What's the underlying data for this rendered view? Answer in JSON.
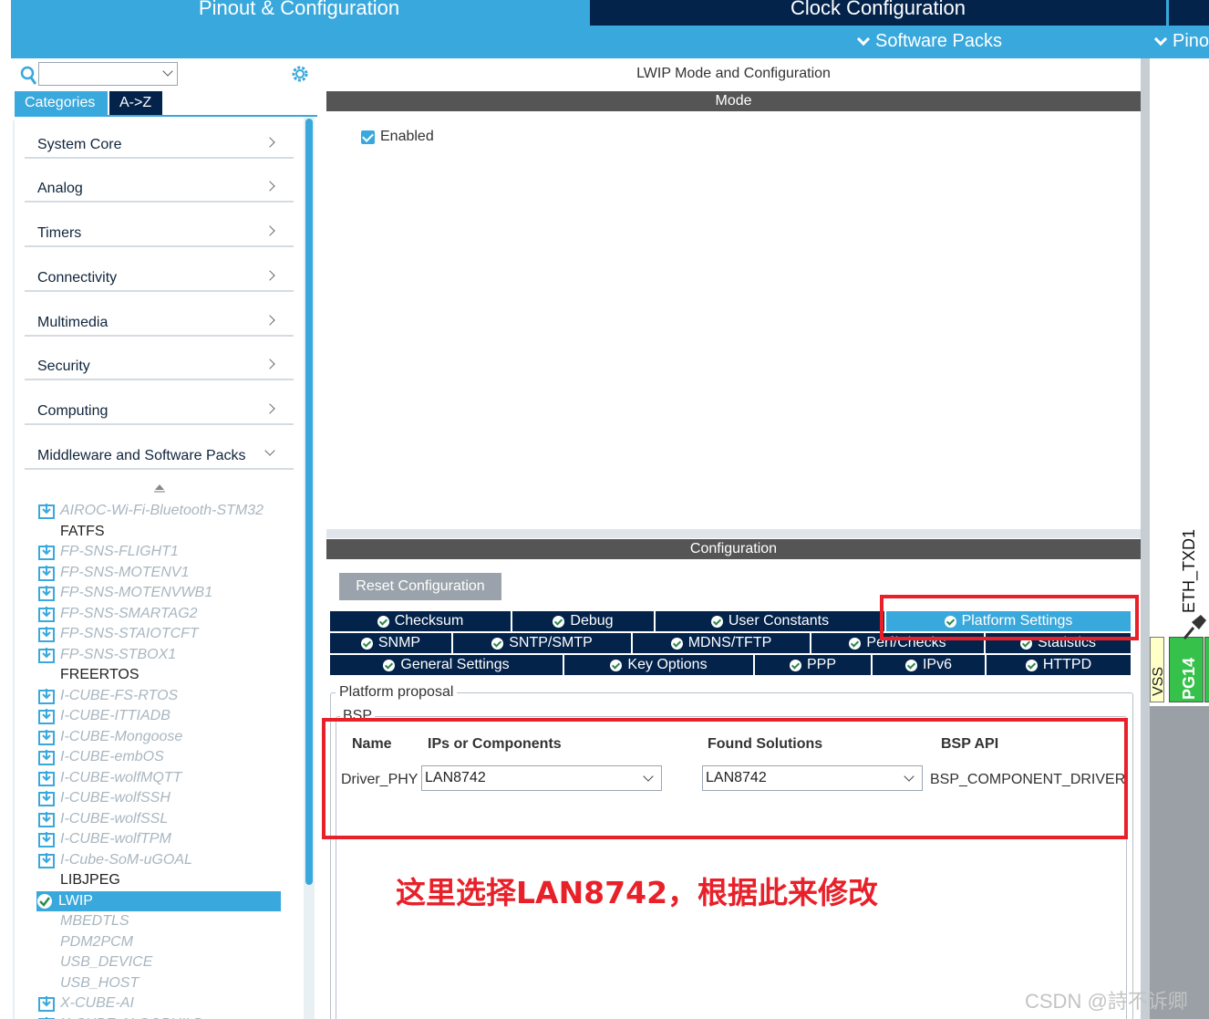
{
  "header": {
    "tab_pinout": "Pinout & Configuration",
    "tab_clock": "Clock Configuration",
    "menu_software_packs": "Software Packs",
    "menu_pinout": "Pinout"
  },
  "sidebar": {
    "tabs": {
      "categories": "Categories",
      "az": "A->Z"
    },
    "categories": [
      {
        "label": "System Core"
      },
      {
        "label": "Analog"
      },
      {
        "label": "Timers"
      },
      {
        "label": "Connectivity"
      },
      {
        "label": "Multimedia"
      },
      {
        "label": "Security"
      },
      {
        "label": "Computing"
      },
      {
        "label": "Middleware and Software Packs"
      }
    ],
    "middleware_items": [
      {
        "label": "AIROC-Wi-Fi-Bluetooth-STM32"
      },
      {
        "label": "FATFS"
      },
      {
        "label": "FP-SNS-FLIGHT1"
      },
      {
        "label": "FP-SNS-MOTENV1"
      },
      {
        "label": "FP-SNS-MOTENVWB1"
      },
      {
        "label": "FP-SNS-SMARTAG2"
      },
      {
        "label": "FP-SNS-STAIOTCFT"
      },
      {
        "label": "FP-SNS-STBOX1"
      },
      {
        "label": "FREERTOS"
      },
      {
        "label": "I-CUBE-FS-RTOS"
      },
      {
        "label": "I-CUBE-ITTIADB"
      },
      {
        "label": "I-CUBE-Mongoose"
      },
      {
        "label": "I-CUBE-embOS"
      },
      {
        "label": "I-CUBE-wolfMQTT"
      },
      {
        "label": "I-CUBE-wolfSSH"
      },
      {
        "label": "I-CUBE-wolfSSL"
      },
      {
        "label": "I-CUBE-wolfTPM"
      },
      {
        "label": "I-Cube-SoM-uGOAL"
      },
      {
        "label": "LIBJPEG"
      },
      {
        "label": "LWIP"
      },
      {
        "label": "MBEDTLS"
      },
      {
        "label": "PDM2PCM"
      },
      {
        "label": "USB_DEVICE"
      },
      {
        "label": "USB_HOST"
      },
      {
        "label": "X-CUBE-AI"
      },
      {
        "label": "X-CUBE-ALGOBUILD"
      }
    ]
  },
  "main": {
    "title": "LWIP Mode and Configuration",
    "mode_header": "Mode",
    "enabled_label": "Enabled",
    "config_header": "Configuration",
    "reset_button": "Reset Configuration",
    "tabs_row1": [
      "Checksum",
      "Debug",
      "User Constants",
      "Platform Settings"
    ],
    "tabs_row2": [
      "SNMP",
      "SNTP/SMTP",
      "MDNS/TFTP",
      "Perf/Checks",
      "Statistics"
    ],
    "tabs_row3": [
      "General Settings",
      "Key Options",
      "PPP",
      "IPv6",
      "HTTPD"
    ],
    "platform_proposal_label": "Platform proposal",
    "bsp_label": "BSP",
    "columns": [
      "Name",
      "IPs or Components",
      "Found Solutions",
      "BSP API"
    ],
    "row": {
      "name": "Driver_PHY",
      "ip_component": "LAN8742",
      "found_solution": "LAN8742",
      "bsp_api": "BSP_COMPONENT_DRIVER"
    }
  },
  "annotation": "这里选择LAN8742，根据此来修改",
  "pins": {
    "eth_label": "ETH_TXD1",
    "vss": "VSS",
    "pg14": "PG14"
  },
  "watermark": "CSDN @詩不诉卿",
  "colors": {
    "accent": "#39a8dc",
    "dark_navy": "#03234b",
    "header_gray": "#555555",
    "highlight_red": "#e8202a",
    "pin_green": "#36c24a"
  }
}
